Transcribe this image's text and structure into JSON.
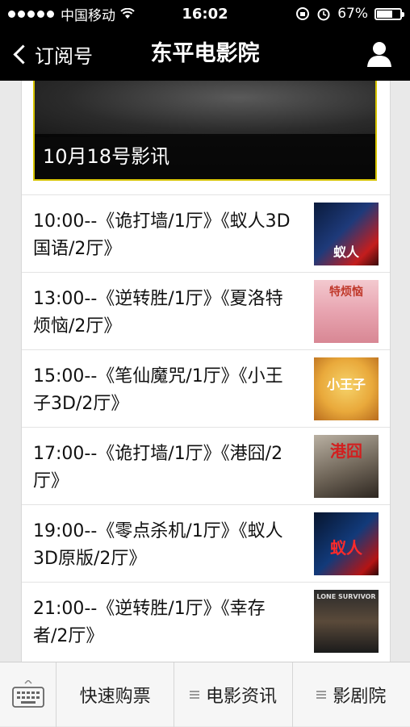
{
  "status_bar": {
    "carrier": "中国移动",
    "time": "16:02",
    "battery": "67%",
    "battery_level": 0.67
  },
  "nav": {
    "back_label": "订阅号",
    "title": "东平电影院",
    "profile_icon": "person-icon"
  },
  "article": {
    "cover_caption": "10月18号影讯",
    "schedule": [
      {
        "text": "10:00--《诡打墙/1厅》《蚁人3D国语/2厅》",
        "thumb_label": "蚁人"
      },
      {
        "text": "13:00--《逆转胜/1厅》《夏洛特烦恼/2厅》",
        "thumb_label": "特烦恼"
      },
      {
        "text": "15:00--《笔仙魔咒/1厅》《小王子3D/2厅》",
        "thumb_label": "小王子"
      },
      {
        "text": "17:00--《诡打墙/1厅》《港囧/2厅》",
        "thumb_label": "港囧"
      },
      {
        "text": "19:00--《零点杀机/1厅》《蚁人3D原版/2厅》",
        "thumb_label": "蚁人"
      },
      {
        "text": "21:00--《逆转胜/1厅》《幸存者/2厅》",
        "thumb_label": "LONE SURVIVOR"
      }
    ]
  },
  "bottom_menu": {
    "keyboard_icon": "keyboard-icon",
    "items": [
      {
        "label": "快速购票"
      },
      {
        "label": "电影资讯"
      },
      {
        "label": "影剧院"
      }
    ]
  },
  "colors": {
    "bar_bg": "#000000",
    "cover_border": "#d6c300",
    "menu_bg": "#f6f6f6"
  }
}
